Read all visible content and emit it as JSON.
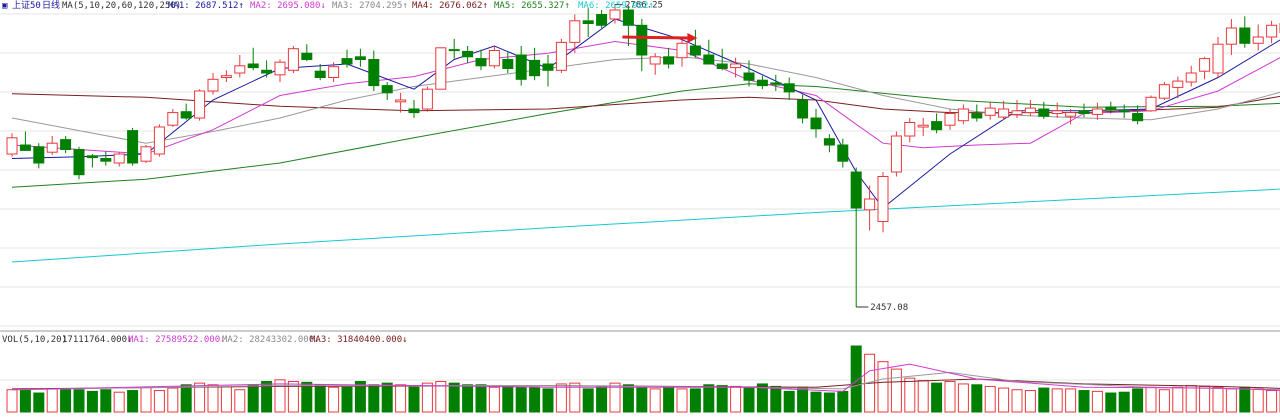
{
  "chart_data": {
    "type": "candlestick",
    "colors": {
      "up": "#e8383d",
      "down": "#007f00",
      "ma1": "#1a1aa0",
      "ma2": "#d23ad2",
      "ma3": "#9a9a9a",
      "ma4": "#7a2020",
      "ma5": "#208020",
      "ma6": "#18c8d0"
    },
    "header": {
      "symbol": "上证50",
      "period": "日线",
      "ma_name": "MA(5,10,20,60,120,250)",
      "ma1": "MA1: 2687.512↑",
      "ma2": "MA2: 2695.080↓",
      "ma3": "MA3: 2704.295↑",
      "ma4": "MA4: 2676.062↑",
      "ma5": "MA5: 2655.327↑",
      "ma6": "MA6: 2659.922↑"
    },
    "annotations": {
      "high": "2786.25",
      "low": "2457.08"
    },
    "price_range": [
      2450,
      2800
    ],
    "candles": [
      [
        2640,
        2663,
        2637,
        2658
      ],
      [
        2650,
        2665,
        2646,
        2644
      ],
      [
        2648,
        2652,
        2624,
        2630
      ],
      [
        2642,
        2660,
        2639,
        2652
      ],
      [
        2656,
        2660,
        2641,
        2645
      ],
      [
        2645,
        2648,
        2612,
        2617
      ],
      [
        2638,
        2640,
        2625,
        2636
      ],
      [
        2635,
        2643,
        2627,
        2632
      ],
      [
        2630,
        2642,
        2626,
        2640
      ],
      [
        2666,
        2669,
        2627,
        2630
      ],
      [
        2632,
        2650,
        2630,
        2648
      ],
      [
        2640,
        2673,
        2637,
        2670
      ],
      [
        2672,
        2690,
        2670,
        2686
      ],
      [
        2687,
        2696,
        2678,
        2680
      ],
      [
        2680,
        2712,
        2677,
        2710
      ],
      [
        2710,
        2730,
        2706,
        2723
      ],
      [
        2725,
        2733,
        2720,
        2727
      ],
      [
        2730,
        2750,
        2725,
        2738
      ],
      [
        2740,
        2758,
        2733,
        2736
      ],
      [
        2733,
        2744,
        2725,
        2730
      ],
      [
        2728,
        2745,
        2720,
        2742
      ],
      [
        2733,
        2760,
        2730,
        2757
      ],
      [
        2752,
        2762,
        2743,
        2745
      ],
      [
        2732,
        2740,
        2722,
        2725
      ],
      [
        2725,
        2742,
        2720,
        2737
      ],
      [
        2746,
        2756,
        2736,
        2740
      ],
      [
        2748,
        2757,
        2737,
        2745
      ],
      [
        2745,
        2755,
        2710,
        2716
      ],
      [
        2716,
        2720,
        2700,
        2708
      ],
      [
        2698,
        2708,
        2686,
        2700
      ],
      [
        2690,
        2700,
        2680,
        2686
      ],
      [
        2690,
        2715,
        2687,
        2712
      ],
      [
        2712,
        2758,
        2712,
        2758
      ],
      [
        2756,
        2768,
        2746,
        2755
      ],
      [
        2754,
        2760,
        2741,
        2748
      ],
      [
        2746,
        2756,
        2733,
        2738
      ],
      [
        2738,
        2760,
        2735,
        2755
      ],
      [
        2745,
        2753,
        2730,
        2735
      ],
      [
        2750,
        2760,
        2716,
        2723
      ],
      [
        2744,
        2758,
        2722,
        2727
      ],
      [
        2740,
        2750,
        2715,
        2733
      ],
      [
        2733,
        2768,
        2730,
        2764
      ],
      [
        2764,
        2795,
        2752,
        2788
      ],
      [
        2788,
        2802,
        2770,
        2785
      ],
      [
        2795,
        2800,
        2780,
        2783
      ],
      [
        2790,
        2806,
        2785,
        2800
      ],
      [
        2800,
        2805,
        2760,
        2783
      ],
      [
        2783,
        2790,
        2732,
        2750
      ],
      [
        2740,
        2752,
        2728,
        2748
      ],
      [
        2748,
        2758,
        2735,
        2740
      ],
      [
        2747,
        2767,
        2737,
        2763
      ],
      [
        2760,
        2778,
        2747,
        2750
      ],
      [
        2750,
        2767,
        2745,
        2740
      ],
      [
        2740,
        2757,
        2733,
        2735
      ],
      [
        2736,
        2747,
        2725,
        2740
      ],
      [
        2730,
        2744,
        2715,
        2722
      ],
      [
        2722,
        2727,
        2712,
        2716
      ],
      [
        2719,
        2728,
        2710,
        2718
      ],
      [
        2718,
        2725,
        2700,
        2709
      ],
      [
        2700,
        2706,
        2674,
        2680
      ],
      [
        2680,
        2690,
        2658,
        2668
      ],
      [
        2657,
        2662,
        2642,
        2650
      ],
      [
        2650,
        2657,
        2625,
        2632
      ],
      [
        2620,
        2625,
        2470,
        2580
      ],
      [
        2578,
        2605,
        2555,
        2590
      ],
      [
        2565,
        2620,
        2553,
        2615
      ],
      [
        2620,
        2665,
        2615,
        2660
      ],
      [
        2660,
        2680,
        2653,
        2675
      ],
      [
        2670,
        2680,
        2660,
        2672
      ],
      [
        2676,
        2685,
        2663,
        2667
      ],
      [
        2672,
        2690,
        2667,
        2685
      ],
      [
        2677,
        2695,
        2673,
        2690
      ],
      [
        2685,
        2695,
        2676,
        2680
      ],
      [
        2683,
        2698,
        2678,
        2691
      ],
      [
        2681,
        2699,
        2678,
        2690
      ],
      [
        2684,
        2700,
        2680,
        2688
      ],
      [
        2686,
        2700,
        2682,
        2691
      ],
      [
        2690,
        2698,
        2679,
        2682
      ],
      [
        2685,
        2697,
        2680,
        2688
      ],
      [
        2682,
        2690,
        2673,
        2686
      ],
      [
        2688,
        2696,
        2681,
        2685
      ],
      [
        2684,
        2697,
        2678,
        2690
      ],
      [
        2692,
        2698,
        2685,
        2689
      ],
      [
        2688,
        2695,
        2680,
        2687
      ],
      [
        2685,
        2694,
        2673,
        2677
      ],
      [
        2688,
        2705,
        2687,
        2703
      ],
      [
        2702,
        2720,
        2700,
        2717
      ],
      [
        2714,
        2726,
        2702,
        2721
      ],
      [
        2720,
        2738,
        2715,
        2730
      ],
      [
        2732,
        2748,
        2723,
        2746
      ],
      [
        2730,
        2770,
        2725,
        2762
      ],
      [
        2762,
        2790,
        2750,
        2780
      ],
      [
        2780,
        2793,
        2758,
        2763
      ],
      [
        2763,
        2784,
        2755,
        2770
      ],
      [
        2770,
        2788,
        2763,
        2783
      ],
      [
        2775,
        2790,
        2770,
        2785
      ],
      [
        2786,
        2803,
        2782,
        2798
      ],
      [
        2792,
        2798,
        2773,
        2778
      ],
      [
        2778,
        2785,
        2763,
        2770
      ],
      [
        2770,
        2783,
        2755,
        2760
      ],
      [
        2762,
        2774,
        2745,
        2750
      ],
      [
        2740,
        2753,
        2735,
        2745
      ],
      [
        2746,
        2758,
        2738,
        2740
      ],
      [
        2731,
        2744,
        2725,
        2735
      ],
      [
        2733,
        2750,
        2730,
        2745
      ],
      [
        2740,
        2755,
        2735,
        2745
      ],
      [
        2745,
        2753,
        2735,
        2740
      ],
      [
        2744,
        2750,
        2737,
        2742
      ]
    ],
    "ma": {
      "ma1": [
        [
          0,
          2635
        ],
        [
          5,
          2637
        ],
        [
          10,
          2640
        ],
        [
          15,
          2700
        ],
        [
          20,
          2735
        ],
        [
          25,
          2740
        ],
        [
          30,
          2712
        ],
        [
          33,
          2745
        ],
        [
          36,
          2760
        ],
        [
          40,
          2735
        ],
        [
          43,
          2768
        ],
        [
          45,
          2790
        ],
        [
          50,
          2767
        ],
        [
          55,
          2735
        ],
        [
          60,
          2700
        ],
        [
          63,
          2620
        ],
        [
          65,
          2580
        ],
        [
          70,
          2640
        ],
        [
          75,
          2688
        ],
        [
          80,
          2688
        ],
        [
          85,
          2690
        ],
        [
          90,
          2725
        ],
        [
          95,
          2770
        ],
        [
          100,
          2780
        ],
        [
          102,
          2762
        ],
        [
          105,
          2747
        ],
        [
          108,
          2743
        ]
      ],
      "ma2": [
        [
          0,
          2650
        ],
        [
          5,
          2645
        ],
        [
          10,
          2640
        ],
        [
          15,
          2667
        ],
        [
          20,
          2705
        ],
        [
          25,
          2718
        ],
        [
          30,
          2726
        ],
        [
          35,
          2745
        ],
        [
          40,
          2752
        ],
        [
          45,
          2765
        ],
        [
          50,
          2755
        ],
        [
          55,
          2722
        ],
        [
          60,
          2705
        ],
        [
          63,
          2673
        ],
        [
          65,
          2652
        ],
        [
          68,
          2647
        ],
        [
          72,
          2650
        ],
        [
          76,
          2652
        ],
        [
          80,
          2685
        ],
        [
          85,
          2688
        ],
        [
          90,
          2710
        ],
        [
          95,
          2750
        ],
        [
          100,
          2773
        ],
        [
          105,
          2760
        ],
        [
          108,
          2752
        ]
      ],
      "ma3": [
        [
          0,
          2680
        ],
        [
          5,
          2666
        ],
        [
          10,
          2652
        ],
        [
          15,
          2665
        ],
        [
          20,
          2680
        ],
        [
          25,
          2700
        ],
        [
          30,
          2715
        ],
        [
          35,
          2725
        ],
        [
          40,
          2735
        ],
        [
          45,
          2745
        ],
        [
          50,
          2748
        ],
        [
          55,
          2740
        ],
        [
          60,
          2725
        ],
        [
          65,
          2705
        ],
        [
          70,
          2690
        ],
        [
          75,
          2683
        ],
        [
          80,
          2680
        ],
        [
          85,
          2678
        ],
        [
          90,
          2690
        ],
        [
          95,
          2710
        ],
        [
          100,
          2738
        ],
        [
          105,
          2752
        ],
        [
          108,
          2757
        ]
      ],
      "ma4": [
        [
          0,
          2707
        ],
        [
          10,
          2703
        ],
        [
          20,
          2693
        ],
        [
          30,
          2688
        ],
        [
          40,
          2690
        ],
        [
          50,
          2700
        ],
        [
          55,
          2703
        ],
        [
          60,
          2700
        ],
        [
          65,
          2690
        ],
        [
          70,
          2686
        ],
        [
          80,
          2686
        ],
        [
          90,
          2692
        ],
        [
          95,
          2705
        ],
        [
          100,
          2718
        ],
        [
          108,
          2732
        ]
      ],
      "ma5": [
        [
          0,
          2603
        ],
        [
          10,
          2612
        ],
        [
          20,
          2630
        ],
        [
          30,
          2658
        ],
        [
          40,
          2685
        ],
        [
          50,
          2710
        ],
        [
          55,
          2718
        ],
        [
          60,
          2715
        ],
        [
          70,
          2700
        ],
        [
          80,
          2692
        ],
        [
          90,
          2693
        ],
        [
          100,
          2700
        ],
        [
          108,
          2703
        ]
      ],
      "ma6": [
        [
          0,
          2520
        ],
        [
          20,
          2540
        ],
        [
          40,
          2558
        ],
        [
          60,
          2575
        ],
        [
          80,
          2590
        ],
        [
          100,
          2605
        ],
        [
          108,
          2612
        ]
      ]
    },
    "volume": {
      "header": {
        "name": "VOL(5,10,20)",
        "vol": "17111764.000↓",
        "ma1": "MA1: 27589522.000↓",
        "ma2": "MA2: 28243302.000↓",
        "ma3": "MA3: 31840400.000↓"
      },
      "ymax": 80,
      "bars": [
        27,
        26,
        23,
        28,
        28,
        27,
        25,
        27,
        24,
        26,
        30,
        26,
        29,
        33,
        35,
        33,
        31,
        27,
        33,
        37,
        39,
        37,
        36,
        33,
        30,
        30,
        37,
        33,
        35,
        33,
        30,
        35,
        37,
        35,
        33,
        33,
        30,
        31,
        30,
        30,
        28,
        34,
        35,
        28,
        31,
        35,
        33,
        30,
        28,
        30,
        28,
        28,
        33,
        32,
        31,
        30,
        34,
        31,
        25,
        30,
        24,
        23,
        25,
        80,
        70,
        61,
        52,
        41,
        38,
        35,
        37,
        34,
        33,
        31,
        29,
        27,
        26,
        29,
        28,
        28,
        26,
        25,
        23,
        24,
        28,
        30,
        27,
        30,
        32,
        31,
        30,
        28,
        30,
        28,
        26,
        27,
        30,
        26,
        23,
        22,
        21,
        22,
        21,
        20,
        22,
        21,
        20,
        21,
        12
      ],
      "ma_lines": {
        "ma1": [
          [
            0,
            27
          ],
          [
            20,
            34
          ],
          [
            40,
            30
          ],
          [
            55,
            30
          ],
          [
            62,
            25
          ],
          [
            64,
            50
          ],
          [
            67,
            58
          ],
          [
            72,
            40
          ],
          [
            80,
            30
          ],
          [
            90,
            29
          ],
          [
            100,
            23
          ],
          [
            108,
            20
          ]
        ],
        "ma2": [
          [
            0,
            27
          ],
          [
            20,
            32
          ],
          [
            40,
            32
          ],
          [
            55,
            30
          ],
          [
            62,
            28
          ],
          [
            65,
            40
          ],
          [
            70,
            48
          ],
          [
            75,
            37
          ],
          [
            85,
            30
          ],
          [
            95,
            27
          ],
          [
            108,
            21
          ]
        ],
        "ma3": [
          [
            0,
            28
          ],
          [
            20,
            31
          ],
          [
            40,
            32
          ],
          [
            60,
            30
          ],
          [
            65,
            36
          ],
          [
            72,
            40
          ],
          [
            80,
            34
          ],
          [
            90,
            31
          ],
          [
            100,
            26
          ],
          [
            108,
            23
          ]
        ]
      }
    }
  }
}
